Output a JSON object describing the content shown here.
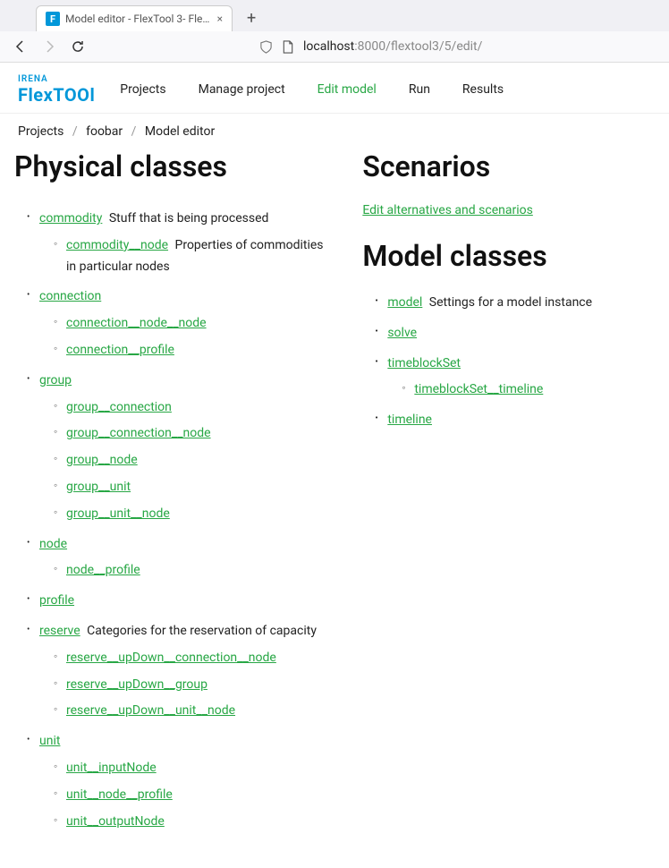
{
  "browser": {
    "tab_title": "Model editor - FlexTool 3- FlexT",
    "tab_favicon_letter": "F",
    "url_host": "localhost",
    "url_port": ":8000/flextool3/5/edit/",
    "new_tab_symbol": "+",
    "close_symbol": "×"
  },
  "brand": {
    "small": "IRENA",
    "main": "FlexTOOl"
  },
  "nav": {
    "projects": "Projects",
    "manage": "Manage project",
    "edit": "Edit model",
    "run": "Run",
    "results": "Results"
  },
  "breadcrumb": {
    "projects": "Projects",
    "project_name": "foobar",
    "current": "Model editor",
    "sep": "/"
  },
  "left": {
    "heading": "Physical classes",
    "items": [
      {
        "name": "commodity",
        "desc": "Stuff that is being processed",
        "children": [
          {
            "name": "commodity__node",
            "desc": "Properties of commodities in particular nodes"
          }
        ]
      },
      {
        "name": "connection",
        "children": [
          {
            "name": "connection__node__node"
          },
          {
            "name": "connection__profile"
          }
        ]
      },
      {
        "name": "group",
        "children": [
          {
            "name": "group__connection"
          },
          {
            "name": "group__connection__node"
          },
          {
            "name": "group__node"
          },
          {
            "name": "group__unit"
          },
          {
            "name": "group__unit__node"
          }
        ]
      },
      {
        "name": "node",
        "children": [
          {
            "name": "node__profile"
          }
        ]
      },
      {
        "name": "profile"
      },
      {
        "name": "reserve",
        "desc": "Categories for the reservation of capacity",
        "children": [
          {
            "name": "reserve__upDown__connection__node"
          },
          {
            "name": "reserve__upDown__group"
          },
          {
            "name": "reserve__upDown__unit__node"
          }
        ]
      },
      {
        "name": "unit",
        "children": [
          {
            "name": "unit__inputNode"
          },
          {
            "name": "unit__node__profile"
          },
          {
            "name": "unit__outputNode"
          }
        ]
      }
    ]
  },
  "right": {
    "scenarios_heading": "Scenarios",
    "edit_alternatives": "Edit alternatives and scenarios",
    "model_heading": "Model classes",
    "items": [
      {
        "name": "model",
        "desc": "Settings for a model instance"
      },
      {
        "name": "solve"
      },
      {
        "name": "timeblockSet",
        "children": [
          {
            "name": "timeblockSet__timeline"
          }
        ]
      },
      {
        "name": "timeline"
      }
    ]
  }
}
